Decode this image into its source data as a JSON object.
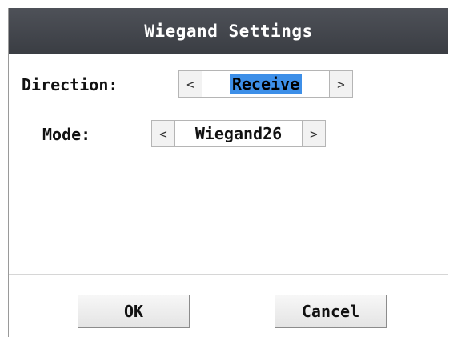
{
  "dialog": {
    "title": "Wiegand Settings"
  },
  "direction": {
    "label": "Direction:",
    "value": "Receive",
    "prev_icon": "<",
    "next_icon": ">"
  },
  "mode": {
    "label": "Mode:",
    "value": "Wiegand26",
    "prev_icon": "<",
    "next_icon": ">"
  },
  "buttons": {
    "ok_label": "OK",
    "cancel_label": "Cancel"
  },
  "colors": {
    "titlebar": "#44474d",
    "selection": "#3d8fe8"
  }
}
